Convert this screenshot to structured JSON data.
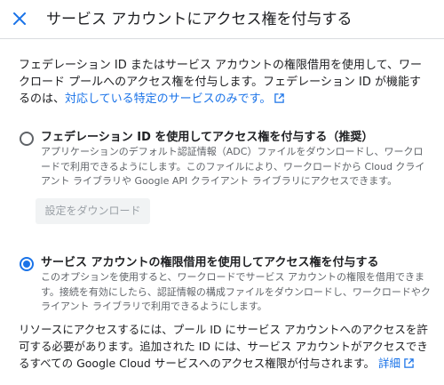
{
  "header": {
    "title": "サービス アカウントにアクセス権を付与する",
    "close_icon": "close-icon"
  },
  "intro": {
    "text": "フェデレーション ID またはサービス アカウントの権限借用を使用して、ワークロード プールへのアクセス権を付与します。フェデレーション ID が機能するのは、",
    "link_label": "対応している特定のサービスのみです。",
    "link_icon": "external-link-icon"
  },
  "options": [
    {
      "title": "フェデレーション ID を使用してアクセス権を付与する（推奨）",
      "description": "アプリケーションのデフォルト認証情報（ADC）ファイルをダウンロードし、ワークロードで利用できるようにします。このファイルにより、ワークロードから Cloud クライアント ライブラリや Google API クライアント ライブラリにアクセスできます。",
      "selected": false,
      "button_label": "設定をダウンロード",
      "button_disabled": true
    },
    {
      "title": "サービス アカウントの権限借用を使用してアクセス権を付与する",
      "description": "このオプションを使用すると、ワークロードでサービス アカウントの権限を借用できます。接続を有効にしたら、認証情報の構成ファイルをダウンロードし、ワークロードやクライアント ライブラリで利用できるようにします。",
      "selected": true
    }
  ],
  "outro": {
    "text": "リソースにアクセスするには、プール ID にサービス アカウントへのアクセスを許可する必要があります。追加された ID には、サービス アカウントがアクセスできるすべての Google Cloud サービスへのアクセス権限が付与されます。",
    "link_label": "詳細",
    "link_icon": "external-link-icon"
  },
  "colors": {
    "accent": "#1a73e8",
    "text": "#202124",
    "secondary_text": "#5f6368",
    "disabled_text": "#9aa0a6"
  }
}
